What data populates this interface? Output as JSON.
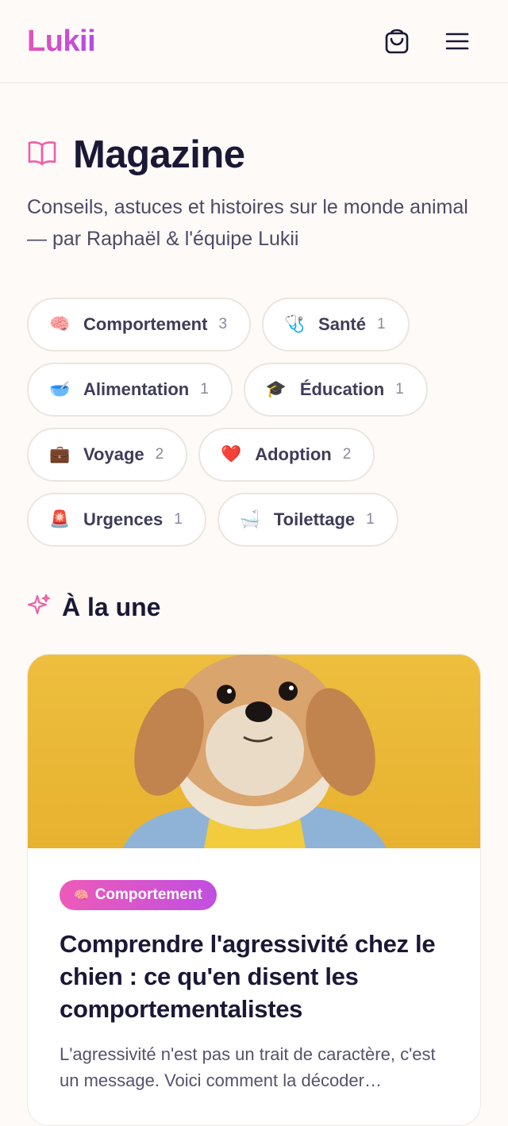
{
  "header": {
    "logo": "Lukii",
    "cart_icon": "shopping-bag-icon",
    "menu_icon": "hamburger-menu-icon"
  },
  "page": {
    "icon": "open-book-icon",
    "title": "Magazine",
    "subtitle": "Conseils, astuces et histoires sur le monde animal — par Raphaël & l'équipe Lukii"
  },
  "categories": [
    {
      "emoji": "🧠",
      "label": "Comportement",
      "count": "3"
    },
    {
      "emoji": "🩺",
      "label": "Santé",
      "count": "1"
    },
    {
      "emoji": "🥣",
      "label": "Alimentation",
      "count": "1"
    },
    {
      "emoji": "🎓",
      "label": "Éducation",
      "count": "1"
    },
    {
      "emoji": "💼",
      "label": "Voyage",
      "count": "2"
    },
    {
      "emoji": "❤️",
      "label": "Adoption",
      "count": "2"
    },
    {
      "emoji": "🚨",
      "label": "Urgences",
      "count": "1"
    },
    {
      "emoji": "🛁",
      "label": "Toilettage",
      "count": "1"
    }
  ],
  "featured": {
    "icon": "sparkles-icon",
    "title": "À la une",
    "article": {
      "badge_emoji": "🧠",
      "badge": "Comportement",
      "title": "Comprendre l'agressivité chez le chien : ce qu'en disent les comportementalistes",
      "excerpt": "L'agressivité n'est pas un trait de caractère, c'est un message. Voici comment la décoder…"
    }
  },
  "colors": {
    "brand_pink": "#e455b8",
    "brand_purple": "#b54ae6",
    "background": "#fdfaf7",
    "text": "#1b1836",
    "photo_background": "#e9b534"
  }
}
